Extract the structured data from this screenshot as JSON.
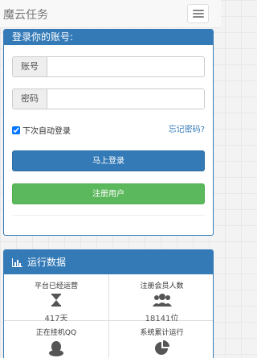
{
  "navbar": {
    "brand": "魔云任务"
  },
  "login": {
    "heading": "登录你的账号:",
    "account_label": "账号",
    "password_label": "密码",
    "remember_label": "下次自动登录",
    "remember_checked": true,
    "forgot_label": "忘记密码?",
    "login_button": "马上登录",
    "register_button": "注册用户"
  },
  "stats": {
    "heading": "运行数据",
    "items": [
      {
        "title": "平台已经运营",
        "value": "417天",
        "icon": "hourglass-icon"
      },
      {
        "title": "注册会员人数",
        "value": "18141位",
        "icon": "users-icon"
      },
      {
        "title": "正在挂机QQ",
        "value": "",
        "icon": "qq-penguin-icon"
      },
      {
        "title": "系统累计运行",
        "value": "",
        "icon": "pie-chart-icon"
      }
    ]
  },
  "colors": {
    "primary": "#337ab7",
    "success": "#5cb85c"
  }
}
